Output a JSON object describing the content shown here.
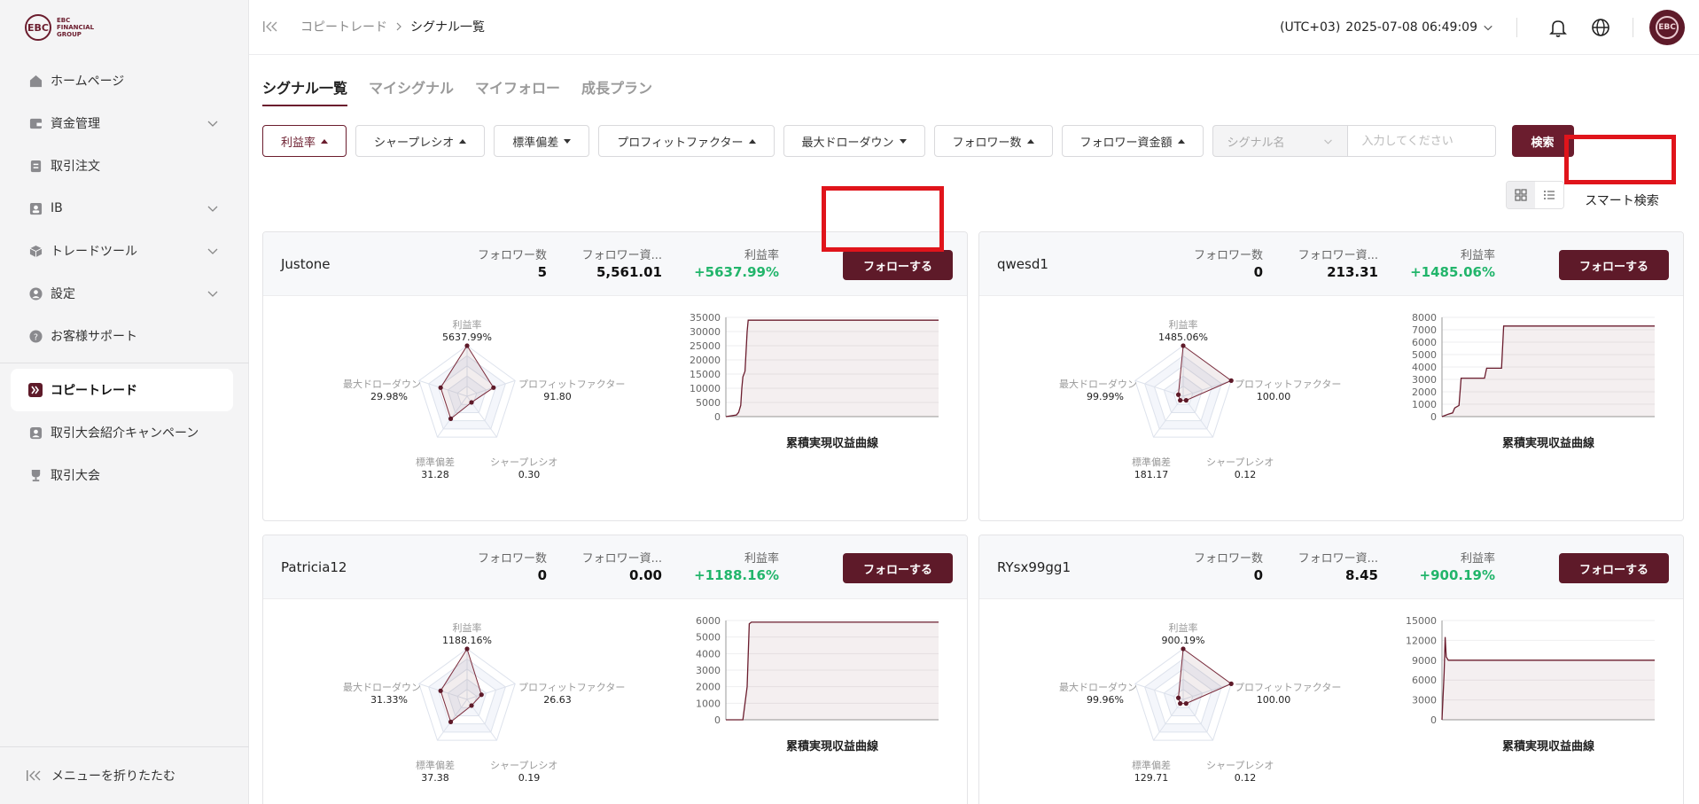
{
  "logo": {
    "mark": "EBC",
    "line1": "EBC",
    "line2": "FINANCIAL",
    "line3": "GROUP"
  },
  "sidebar": {
    "items": [
      {
        "label": "ホームページ",
        "icon": "home-icon"
      },
      {
        "label": "資金管理",
        "icon": "wallet-icon"
      },
      {
        "label": "取引注文",
        "icon": "order-icon"
      },
      {
        "label": "IB",
        "icon": "ib-icon"
      },
      {
        "label": "トレードツール",
        "icon": "cube-icon"
      },
      {
        "label": "設定",
        "icon": "user-icon"
      },
      {
        "label": "お客様サポート",
        "icon": "help-icon"
      },
      {
        "label": "コピートレード",
        "icon": "copy-trade-icon"
      },
      {
        "label": "取引大会紹介キャンペーン",
        "icon": "referral-icon"
      },
      {
        "label": "取引大会",
        "icon": "trophy-icon"
      }
    ],
    "collapse_label": "メニューを折りたたむ"
  },
  "header": {
    "breadcrumb": [
      "コピートレード",
      "シグナル一覧"
    ],
    "timezone": "(UTC+03)",
    "datetime": "2025-07-08 06:49:09"
  },
  "tabs": [
    "シグナル一覧",
    "マイシグナル",
    "マイフォロー",
    "成長プラン"
  ],
  "filters": [
    {
      "label": "利益率",
      "dir": "up"
    },
    {
      "label": "シャープレシオ",
      "dir": "up"
    },
    {
      "label": "標準偏差",
      "dir": "down"
    },
    {
      "label": "プロフィットファクター",
      "dir": "up"
    },
    {
      "label": "最大ドローダウン",
      "dir": "down"
    },
    {
      "label": "フォロワー数",
      "dir": "up"
    },
    {
      "label": "フォロワー資金額",
      "dir": "up"
    }
  ],
  "search": {
    "select_placeholder": "シグナル名",
    "input_placeholder": "入力してください",
    "button": "検索"
  },
  "smart_search": "スマート検索",
  "card_labels": {
    "followers": "フォロワー数",
    "funds": "フォロワー資...",
    "profit": "利益率",
    "follow_btn": "フォローする",
    "curve_title": "累積実現収益曲線",
    "radar": {
      "profit": "利益率",
      "pf": "プロフィットファクター",
      "sharpe": "シャープレシオ",
      "std": "標準偏差",
      "mdd": "最大ドローダウン"
    }
  },
  "cards": [
    {
      "name": "Justone",
      "followers": "5",
      "funds": "5,561.01",
      "profit": "+5637.99%",
      "radar": {
        "profit": "5637.99%",
        "pf": "91.80",
        "sharpe": "0.30",
        "std": "31.28",
        "mdd": "29.98%"
      },
      "radar_levels": [
        1.0,
        0.55,
        0.15,
        0.55,
        0.55
      ],
      "curve": {
        "yticks": [
          "35000",
          "30000",
          "25000",
          "20000",
          "15000",
          "10000",
          "5000",
          "0"
        ],
        "ymax": 35000,
        "points": [
          [
            0,
            0
          ],
          [
            0.05,
            600
          ],
          [
            0.06,
            1500
          ],
          [
            0.07,
            4000
          ],
          [
            0.075,
            10000
          ],
          [
            0.08,
            14000
          ],
          [
            0.09,
            16000
          ],
          [
            0.1,
            30000
          ],
          [
            0.105,
            34000
          ],
          [
            1,
            34000
          ]
        ]
      }
    },
    {
      "name": "qwesd1",
      "followers": "0",
      "funds": "213.31",
      "profit": "+1485.06%",
      "radar": {
        "profit": "1485.06%",
        "pf": "100.00",
        "sharpe": "0.12",
        "std": "181.17",
        "mdd": "99.99%"
      },
      "radar_levels": [
        1.0,
        1.0,
        0.1,
        0.1,
        0.1
      ],
      "curve": {
        "yticks": [
          "8000",
          "7000",
          "6000",
          "5000",
          "4000",
          "3000",
          "2000",
          "1000",
          "0"
        ],
        "ymax": 8000,
        "points": [
          [
            0,
            0
          ],
          [
            0.03,
            200
          ],
          [
            0.05,
            300
          ],
          [
            0.06,
            700
          ],
          [
            0.08,
            900
          ],
          [
            0.09,
            3100
          ],
          [
            0.2,
            3100
          ],
          [
            0.21,
            3900
          ],
          [
            0.28,
            3900
          ],
          [
            0.29,
            7300
          ],
          [
            1,
            7300
          ]
        ]
      }
    },
    {
      "name": "Patricia12",
      "followers": "0",
      "funds": "0.00",
      "profit": "+1188.16%",
      "radar": {
        "profit": "1188.16%",
        "pf": "26.63",
        "sharpe": "0.19",
        "std": "37.38",
        "mdd": "31.33%"
      },
      "radar_levels": [
        1.0,
        0.3,
        0.15,
        0.55,
        0.55
      ],
      "curve": {
        "yticks": [
          "6000",
          "5000",
          "4000",
          "3000",
          "2000",
          "1000",
          "0"
        ],
        "ymax": 6000,
        "points": [
          [
            0,
            0
          ],
          [
            0.08,
            0
          ],
          [
            0.1,
            2000
          ],
          [
            0.11,
            5800
          ],
          [
            0.12,
            5900
          ],
          [
            1,
            5900
          ]
        ]
      }
    },
    {
      "name": "RYsx99gg1",
      "followers": "0",
      "funds": "8.45",
      "profit": "+900.19%",
      "radar": {
        "profit": "900.19%",
        "pf": "100.00",
        "sharpe": "0.12",
        "std": "129.71",
        "mdd": "99.96%"
      },
      "radar_levels": [
        1.0,
        1.0,
        0.1,
        0.1,
        0.1
      ],
      "curve": {
        "yticks": [
          "15000",
          "12000",
          "9000",
          "6000",
          "3000",
          "0"
        ],
        "ymax": 15000,
        "points": [
          [
            0,
            0
          ],
          [
            0.01,
            7000
          ],
          [
            0.015,
            12500
          ],
          [
            0.02,
            9500
          ],
          [
            0.03,
            9000
          ],
          [
            1,
            9000
          ]
        ]
      }
    }
  ],
  "colors": {
    "brand": "#5e1a29",
    "accent": "#6b1d2e",
    "green": "#22b56b",
    "highlight": "#e0141b"
  }
}
